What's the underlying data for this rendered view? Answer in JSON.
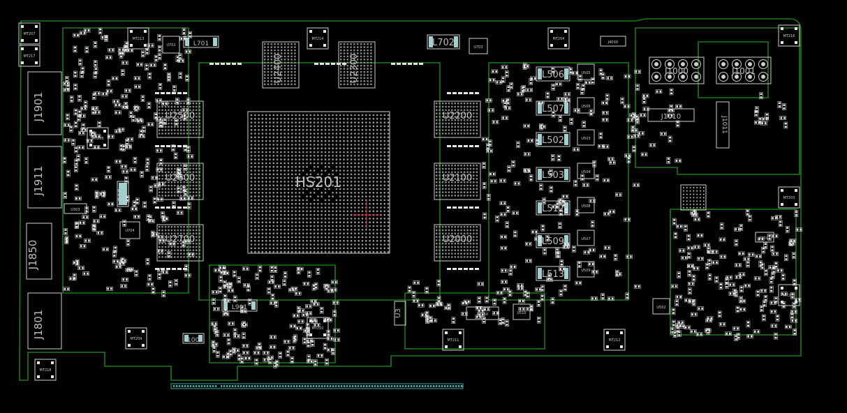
{
  "board": {
    "main_gpu": "HS201",
    "memory": [
      "U2400",
      "U2300",
      "U2500",
      "U2600",
      "U2700",
      "U2200",
      "U2100",
      "U2000"
    ],
    "connectors": [
      "J1901",
      "J1911",
      "J1850",
      "J1801"
    ],
    "power_connectors": [
      "J1000",
      "J1001",
      "J1010",
      "J1011",
      "J4010"
    ],
    "inductors": [
      "L506",
      "L507",
      "L502",
      "L503",
      "L512",
      "L509",
      "L513",
      "L702",
      "L703",
      "L701",
      "L901",
      "L1002"
    ],
    "mosfets": [
      "U505",
      "U506",
      "U503",
      "U504",
      "U508",
      "U507",
      "U509",
      "U510",
      "U502"
    ],
    "mount_holes": [
      "MT207",
      "MT217",
      "MT213",
      "MT214",
      "MT204",
      "MT216",
      "MT203",
      "MT200",
      "MT209",
      "MT208",
      "MT210",
      "MT211",
      "MT212",
      "MT218"
    ],
    "misc": [
      "U703",
      "U702",
      "U704",
      "U303",
      "U3",
      "U2013",
      "U1816"
    ]
  },
  "colors": {
    "background": "#000000",
    "outline": "#1e7a1e",
    "silkscreen": "#cfcfcf",
    "pad": "#e6e6e6",
    "edge_connector": "#3fa8a8",
    "crosshair": "#c83232"
  }
}
